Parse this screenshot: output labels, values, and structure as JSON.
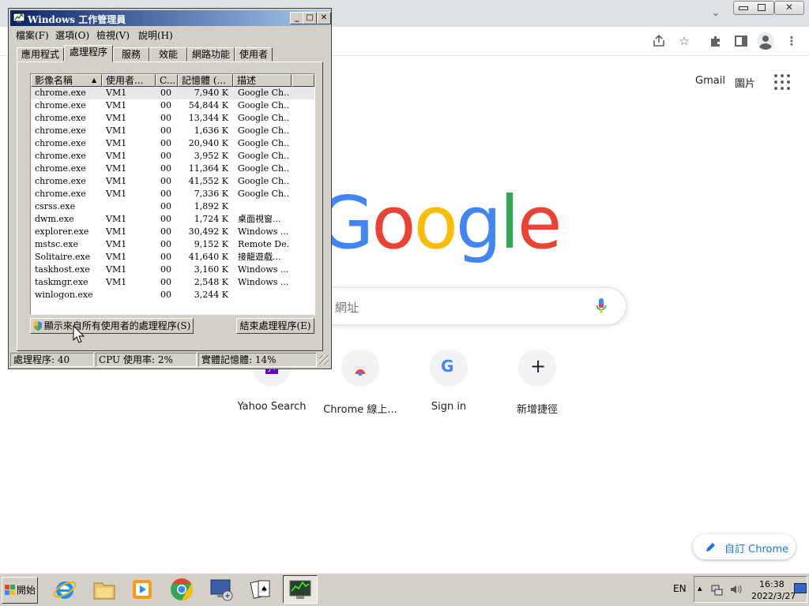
{
  "chrome": {
    "top_links": {
      "gmail": "Gmail",
      "images": "圖片"
    },
    "search_placeholder": "網址",
    "shortcuts": [
      {
        "label": "Yahoo Search",
        "icon": "yahoo-icon"
      },
      {
        "label": "Chrome 線上...",
        "icon": "chrome-webstore-icon"
      },
      {
        "label": "Sign in",
        "icon": "google-g-icon"
      },
      {
        "label": "新增捷徑",
        "icon": "plus-icon"
      }
    ],
    "customize_label": "自訂 Chrome",
    "colors": {
      "blue": "#4285f4",
      "red": "#ea4335",
      "yellow": "#fbbc05",
      "green": "#34a853",
      "accent": "#1a73e8"
    }
  },
  "taskmgr": {
    "title": "Windows 工作管理員",
    "menu": [
      "檔案(F)",
      "選項(O)",
      "檢視(V)",
      "說明(H)"
    ],
    "tabs": [
      "應用程式",
      "處理程序",
      "服務",
      "效能",
      "網路功能",
      "使用者"
    ],
    "active_tab": "處理程序",
    "columns": [
      "影像名稱",
      "使用者...",
      "C...",
      "記憶體 (...",
      "描述"
    ],
    "rows": [
      {
        "name": "chrome.exe",
        "user": "VM1",
        "cpu": "00",
        "mem": "7,940 K",
        "desc": "Google Ch..."
      },
      {
        "name": "chrome.exe",
        "user": "VM1",
        "cpu": "00",
        "mem": "54,844 K",
        "desc": "Google Ch..."
      },
      {
        "name": "chrome.exe",
        "user": "VM1",
        "cpu": "00",
        "mem": "13,344 K",
        "desc": "Google Ch..."
      },
      {
        "name": "chrome.exe",
        "user": "VM1",
        "cpu": "00",
        "mem": "1,636 K",
        "desc": "Google Ch..."
      },
      {
        "name": "chrome.exe",
        "user": "VM1",
        "cpu": "00",
        "mem": "20,940 K",
        "desc": "Google Ch..."
      },
      {
        "name": "chrome.exe",
        "user": "VM1",
        "cpu": "00",
        "mem": "3,952 K",
        "desc": "Google Ch..."
      },
      {
        "name": "chrome.exe",
        "user": "VM1",
        "cpu": "00",
        "mem": "11,364 K",
        "desc": "Google Ch..."
      },
      {
        "name": "chrome.exe",
        "user": "VM1",
        "cpu": "00",
        "mem": "41,552 K",
        "desc": "Google Ch..."
      },
      {
        "name": "chrome.exe",
        "user": "VM1",
        "cpu": "00",
        "mem": "7,336 K",
        "desc": "Google Ch..."
      },
      {
        "name": "csrss.exe",
        "user": "",
        "cpu": "00",
        "mem": "1,892 K",
        "desc": ""
      },
      {
        "name": "dwm.exe",
        "user": "VM1",
        "cpu": "00",
        "mem": "1,724 K",
        "desc": "桌面視窗..."
      },
      {
        "name": "explorer.exe",
        "user": "VM1",
        "cpu": "00",
        "mem": "30,492 K",
        "desc": "Windows ..."
      },
      {
        "name": "mstsc.exe",
        "user": "VM1",
        "cpu": "00",
        "mem": "9,152 K",
        "desc": "Remote De..."
      },
      {
        "name": "Solitaire.exe",
        "user": "VM1",
        "cpu": "00",
        "mem": "41,640 K",
        "desc": "接龍遊戲..."
      },
      {
        "name": "taskhost.exe",
        "user": "VM1",
        "cpu": "00",
        "mem": "3,160 K",
        "desc": "Windows ..."
      },
      {
        "name": "taskmgr.exe",
        "user": "VM1",
        "cpu": "00",
        "mem": "2,548 K",
        "desc": "Windows ..."
      },
      {
        "name": "winlogon.exe",
        "user": "",
        "cpu": "00",
        "mem": "3,244 K",
        "desc": ""
      }
    ],
    "show_all_button": "顯示來自所有使用者的處理程序(S)",
    "end_process_button": "結束處理程序(E)",
    "status": {
      "processes": "處理程序: 40",
      "cpu": "CPU 使用率: 2%",
      "memory": "實體記憶體: 14%"
    }
  },
  "taskbar": {
    "start_label": "開始",
    "apps": [
      "internet-explorer-icon",
      "file-explorer-icon",
      "media-player-icon",
      "chrome-icon",
      "remote-desktop-icon",
      "solitaire-icon",
      "task-manager-icon"
    ],
    "language": "EN",
    "time": "16:38",
    "date": "2022/3/27"
  }
}
